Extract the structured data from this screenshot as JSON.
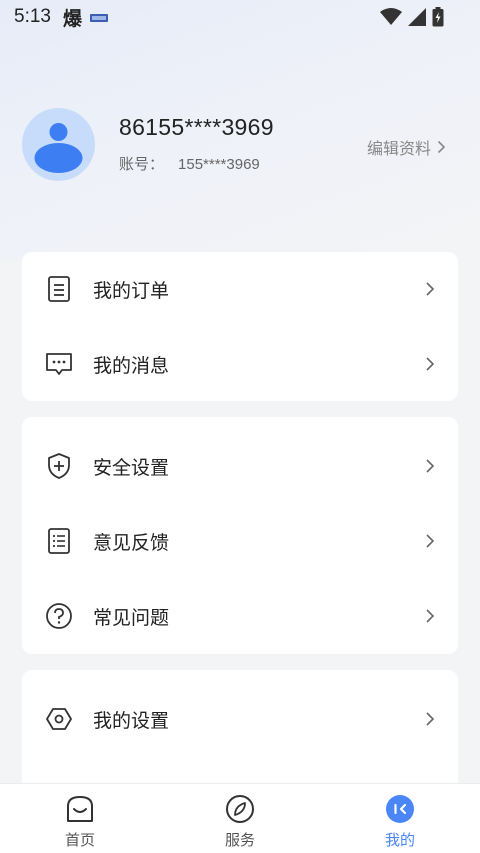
{
  "status_bar": {
    "time": "5:13",
    "app_glyph": "爆"
  },
  "profile": {
    "name": "86155****3969",
    "account_label": "账号：",
    "account_value": "155****3969",
    "edit_label": "编辑资料"
  },
  "menu_groups": [
    {
      "items": [
        {
          "label": "我的订单",
          "icon": "document-icon"
        },
        {
          "label": "我的消息",
          "icon": "message-icon"
        }
      ]
    },
    {
      "items": [
        {
          "label": "安全设置",
          "icon": "shield-plus-icon"
        },
        {
          "label": "意见反馈",
          "icon": "list-icon"
        },
        {
          "label": "常见问题",
          "icon": "question-icon"
        }
      ]
    },
    {
      "items": [
        {
          "label": "我的设置",
          "icon": "hexagon-settings-icon"
        }
      ]
    }
  ],
  "tabbar": {
    "tabs": [
      {
        "label": "首页",
        "icon": "home-icon",
        "active": false
      },
      {
        "label": "服务",
        "icon": "compass-icon",
        "active": false
      },
      {
        "label": "我的",
        "icon": "me-icon",
        "active": true
      }
    ]
  },
  "colors": {
    "accent": "#4a86f7",
    "avatar_bg": "#c7dcfb",
    "avatar_fg": "#3d7ff3"
  }
}
